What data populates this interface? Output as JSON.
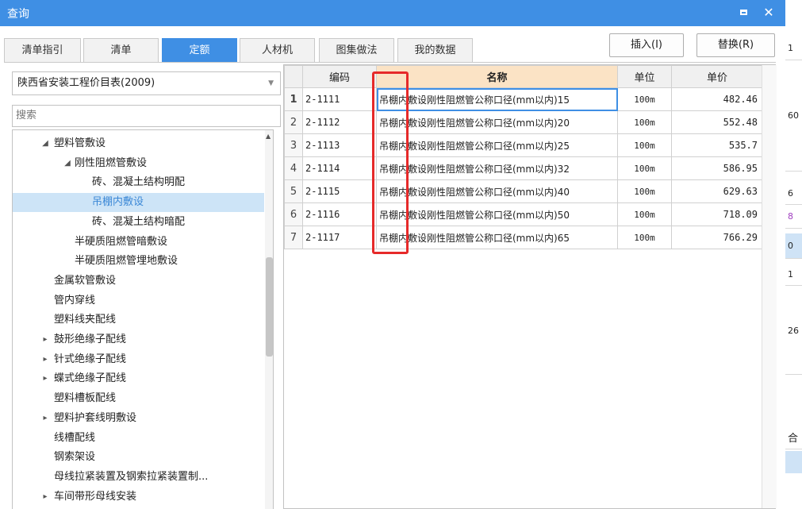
{
  "window": {
    "title": "查询"
  },
  "tabs": [
    {
      "label": "清单指引",
      "active": false
    },
    {
      "label": "清单",
      "active": false
    },
    {
      "label": "定额",
      "active": true
    },
    {
      "label": "人材机",
      "active": false
    },
    {
      "label": "图集做法",
      "active": false
    },
    {
      "label": "我的数据",
      "active": false
    }
  ],
  "buttons": {
    "insert": "插入(I)",
    "replace": "替换(R)"
  },
  "filter": {
    "library": "陕西省安装工程价目表(2009)",
    "search_placeholder": "搜索"
  },
  "tree": [
    {
      "label": "塑料管敷设",
      "expander": "◢"
    },
    {
      "label": "刚性阻燃管敷设",
      "expander": "◢"
    },
    {
      "label": "砖、混凝土结构明配",
      "expander": ""
    },
    {
      "label": "吊棚内敷设",
      "expander": "",
      "selected": true
    },
    {
      "label": "砖、混凝土结构暗配",
      "expander": ""
    },
    {
      "label": "半硬质阻燃管暗敷设",
      "expander": ""
    },
    {
      "label": "半硬质阻燃管埋地敷设",
      "expander": ""
    },
    {
      "label": "金属软管敷设",
      "expander": ""
    },
    {
      "label": "管内穿线",
      "expander": ""
    },
    {
      "label": "塑料线夹配线",
      "expander": ""
    },
    {
      "label": "鼓形绝缘子配线",
      "expander": "▸"
    },
    {
      "label": "针式绝缘子配线",
      "expander": "▸"
    },
    {
      "label": "蝶式绝缘子配线",
      "expander": "▸"
    },
    {
      "label": "塑料槽板配线",
      "expander": ""
    },
    {
      "label": "塑料护套线明敷设",
      "expander": "▸"
    },
    {
      "label": "线槽配线",
      "expander": ""
    },
    {
      "label": "钢索架设",
      "expander": ""
    },
    {
      "label": "母线拉紧装置及钢索拉紧装置制...",
      "expander": ""
    },
    {
      "label": "车间带形母线安装",
      "expander": "▸"
    }
  ],
  "table": {
    "headers": {
      "code": "编码",
      "name": "名称",
      "unit": "单位",
      "price": "单价"
    },
    "rows": [
      {
        "n": "1",
        "code": "2-1111",
        "name": "吊棚内敷设刚性阻燃管公称口径(mm以内)15",
        "unit": "100m",
        "price": "482.46"
      },
      {
        "n": "2",
        "code": "2-1112",
        "name": "吊棚内敷设刚性阻燃管公称口径(mm以内)20",
        "unit": "100m",
        "price": "552.48"
      },
      {
        "n": "3",
        "code": "2-1113",
        "name": "吊棚内敷设刚性阻燃管公称口径(mm以内)25",
        "unit": "100m",
        "price": "535.7"
      },
      {
        "n": "4",
        "code": "2-1114",
        "name": "吊棚内敷设刚性阻燃管公称口径(mm以内)32",
        "unit": "100m",
        "price": "586.95"
      },
      {
        "n": "5",
        "code": "2-1115",
        "name": "吊棚内敷设刚性阻燃管公称口径(mm以内)40",
        "unit": "100m",
        "price": "629.63"
      },
      {
        "n": "6",
        "code": "2-1116",
        "name": "吊棚内敷设刚性阻燃管公称口径(mm以内)50",
        "unit": "100m",
        "price": "718.09"
      },
      {
        "n": "7",
        "code": "2-1117",
        "name": "吊棚内敷设刚性阻燃管公称口径(mm以内)65",
        "unit": "100m",
        "price": "766.29"
      }
    ]
  },
  "background_right": [
    "1",
    "60",
    "6",
    "8",
    "0",
    "1",
    "26",
    "合"
  ]
}
